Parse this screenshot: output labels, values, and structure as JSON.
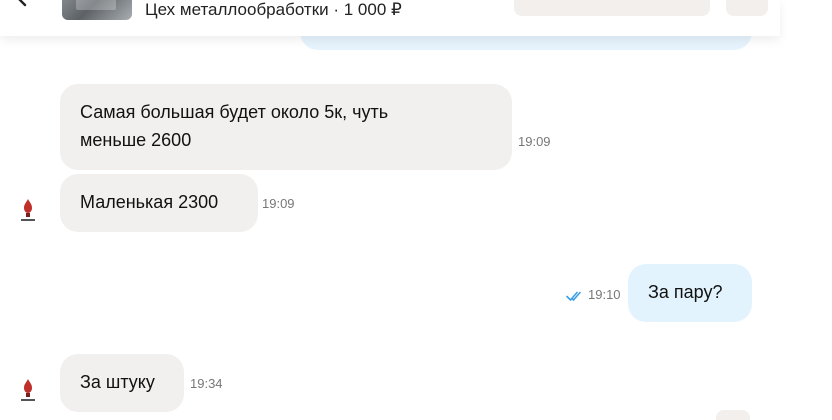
{
  "header": {
    "listing_title": "Цех металлообработки · 1 000 ₽"
  },
  "messages": [
    {
      "direction": "incoming",
      "lines": [
        "Самая большая будет  около 5к, чуть",
        "меньше  2600"
      ],
      "time": "19:09"
    },
    {
      "direction": "incoming",
      "text": "Маленькая 2300",
      "time": "19:09"
    },
    {
      "direction": "outgoing",
      "text": "За пару?",
      "time": "19:10",
      "status": "read"
    },
    {
      "direction": "incoming",
      "text": "За штуку",
      "time": "19:34"
    }
  ],
  "colors": {
    "incoming_bubble": "#f2f0ee",
    "outgoing_bubble": "#e3f3fd",
    "read_checks": "#3b9ee8",
    "avatar_accent": "#c0302b"
  },
  "icons": {
    "back": "chevron-left-icon",
    "read": "double-check-icon",
    "avatar": "seller-logo-icon"
  }
}
